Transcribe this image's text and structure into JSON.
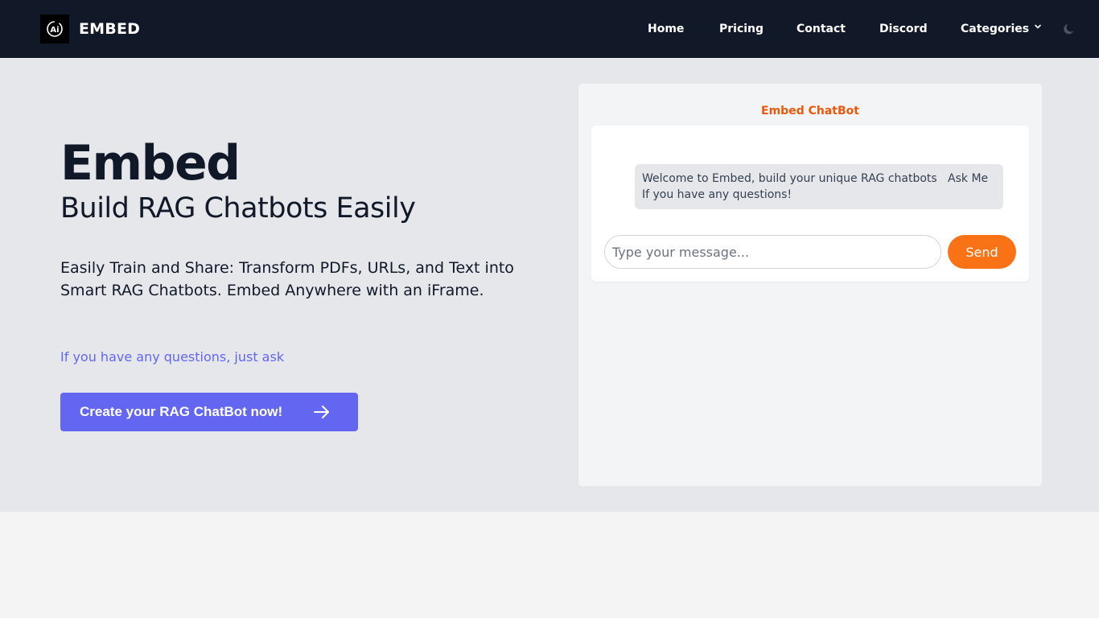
{
  "nav": {
    "brand": "EMBED",
    "logo_icon": "ai-logo-icon",
    "links": [
      "Home",
      "Pricing",
      "Contact",
      "Discord",
      "Categories"
    ],
    "theme_icon": "moon-icon"
  },
  "hero": {
    "title": "Embed",
    "subtitle": "Build RAG Chatbots Easily",
    "description": "Easily Train and Share: Transform PDFs, URLs, and Text into Smart RAG Chatbots. Embed Anywhere with an iFrame.",
    "ask_link": "If you have any questions, just ask",
    "cta_label": "Create your RAG ChatBot now!"
  },
  "chatbot": {
    "title": "Embed ChatBot",
    "welcome_message": "Welcome to Embed, build your unique RAG chatbots   Ask Me If you have any questions!",
    "input_placeholder": "Type your message...",
    "send_label": "Send"
  },
  "colors": {
    "navbar_bg": "#111827",
    "hero_bg": "#e5e7eb",
    "accent_indigo": "#6366f1",
    "accent_orange": "#f97316",
    "chat_title": "#ea580c"
  }
}
